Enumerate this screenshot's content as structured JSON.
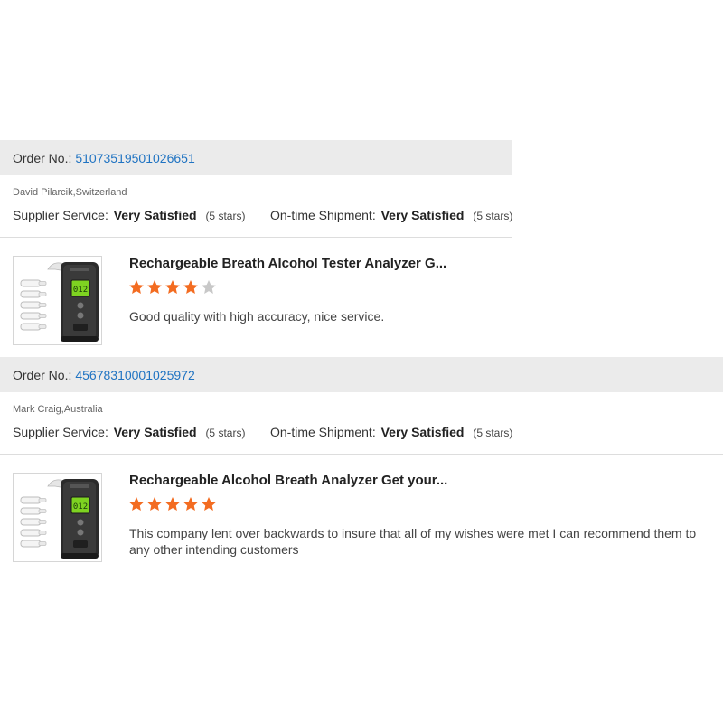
{
  "reviews": [
    {
      "order_label": "Order No.:",
      "order_number": "51073519501026651",
      "reviewer": "David Pilarcik,Switzerland",
      "supplier_label": "Supplier Service:",
      "supplier_value": "Very Satisfied",
      "supplier_stars": "(5 stars)",
      "shipment_label": "On-time Shipment:",
      "shipment_value": "Very Satisfied",
      "shipment_stars": "(5 stars)",
      "product_title": "Rechargeable Breath Alcohol Tester Analyzer G...",
      "rating": 4,
      "rating_max": 5,
      "comment": "Good quality with high accuracy, nice service.",
      "thumb_icon": "breathalyzer-product-image"
    },
    {
      "order_label": "Order No.:",
      "order_number": "45678310001025972",
      "reviewer": "Mark Craig,Australia",
      "supplier_label": "Supplier Service:",
      "supplier_value": "Very Satisfied",
      "supplier_stars": "(5 stars)",
      "shipment_label": "On-time Shipment:",
      "shipment_value": "Very Satisfied",
      "shipment_stars": "(5 stars)",
      "product_title": "Rechargeable Alcohol Breath Analyzer Get your...",
      "rating": 5,
      "rating_max": 5,
      "comment": "This company lent over backwards to insure that all of my wishes were met I can recommend them to any other intending customers",
      "thumb_icon": "breathalyzer-product-image"
    }
  ],
  "colors": {
    "order_bar": "#ebebeb",
    "order_link": "#1f73c2",
    "star_filled": "#f36c21",
    "star_empty": "#c8c8c8",
    "device_screen": "#7ed321"
  }
}
